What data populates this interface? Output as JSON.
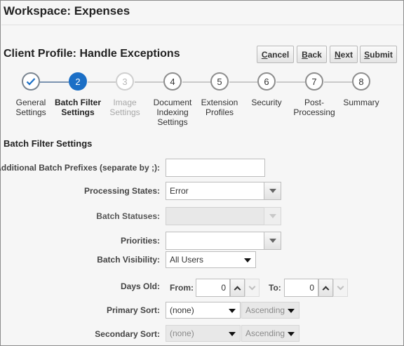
{
  "workspace_title": "Workspace: Expenses",
  "page_title": "Client Profile: Handle Exceptions",
  "buttons": {
    "cancel": {
      "acc": "C",
      "rest": "ancel"
    },
    "back": {
      "acc": "B",
      "rest": "ack"
    },
    "next": {
      "acc": "N",
      "rest": "ext"
    },
    "submit": {
      "acc": "S",
      "rest": "ubmit"
    }
  },
  "train": [
    {
      "number": "✓",
      "l1": "General",
      "l2": "Settings",
      "l3": "",
      "state": "visited"
    },
    {
      "number": "2",
      "l1": "Batch Filter",
      "l2": "Settings",
      "l3": "",
      "state": "current"
    },
    {
      "number": "3",
      "l1": "Image",
      "l2": "Settings",
      "l3": "",
      "state": "disabled"
    },
    {
      "number": "4",
      "l1": "Document",
      "l2": "Indexing",
      "l3": "Settings",
      "state": "normal"
    },
    {
      "number": "5",
      "l1": "Extension",
      "l2": "Profiles",
      "l3": "",
      "state": "normal"
    },
    {
      "number": "6",
      "l1": "Security",
      "l2": "",
      "l3": "",
      "state": "normal"
    },
    {
      "number": "7",
      "l1": "Post-",
      "l2": "Processing",
      "l3": "",
      "state": "normal"
    },
    {
      "number": "8",
      "l1": "Summary",
      "l2": "",
      "l3": "",
      "state": "normal"
    }
  ],
  "section_title": "Batch Filter Settings",
  "form": {
    "prefixes_label": "Additional Batch Prefixes (separate by ;):",
    "prefixes_value": "",
    "processing_states_label": "Processing States:",
    "processing_states_value": "Error",
    "batch_statuses_label": "Batch Statuses:",
    "batch_statuses_value": "",
    "priorities_label": "Priorities:",
    "priorities_value": "",
    "batch_visibility_label": "Batch Visibility:",
    "batch_visibility_value": "All Users",
    "days_old_label": "Days Old:",
    "from_label": "From:",
    "from_value": "0",
    "to_label": "To:",
    "to_value": "0",
    "primary_sort_label": "Primary Sort:",
    "primary_sort_value": "(none)",
    "primary_order_value": "Ascending",
    "secondary_sort_label": "Secondary Sort:",
    "secondary_sort_value": "(none)",
    "secondary_order_value": "Ascending"
  },
  "colors": {
    "accent": "#1b6fc6",
    "checkmark": "#1b6fc6"
  }
}
